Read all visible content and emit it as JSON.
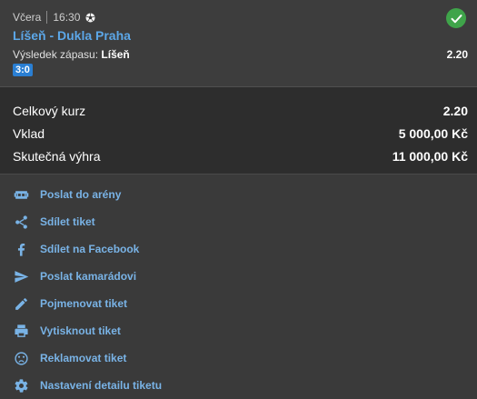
{
  "bet": {
    "day": "Včera",
    "time": "16:30",
    "sport_icon": "soccer-ball-icon",
    "status_icon": "check-circle-icon",
    "match": "Líšeň - Dukla Praha",
    "result_label": "Výsledek zápasu:",
    "result_pick": "Líšeň",
    "odds": "2.20",
    "score": "3:0"
  },
  "summary": {
    "total_odds_label": "Celkový kurz",
    "total_odds_value": "2.20",
    "stake_label": "Vklad",
    "stake_value": "5 000,00 Kč",
    "win_label": "Skutečná výhra",
    "win_value": "11 000,00 Kč"
  },
  "actions": [
    {
      "label": "Poslat do arény",
      "icon": "arena-icon"
    },
    {
      "label": "Sdílet tiket",
      "icon": "share-icon"
    },
    {
      "label": "Sdílet na Facebook",
      "icon": "facebook-icon"
    },
    {
      "label": "Poslat kamarádovi",
      "icon": "send-icon"
    },
    {
      "label": "Pojmenovat tiket",
      "icon": "pencil-icon"
    },
    {
      "label": "Vytisknout tiket",
      "icon": "printer-icon"
    },
    {
      "label": "Reklamovat tiket",
      "icon": "sad-face-icon"
    },
    {
      "label": "Nastavení detailu tiketu",
      "icon": "gear-icon"
    }
  ],
  "colors": {
    "accent": "#79b3e6",
    "match_link": "#5ca7e8",
    "success": "#3fa44a",
    "score_badge": "#2a7fd3"
  }
}
